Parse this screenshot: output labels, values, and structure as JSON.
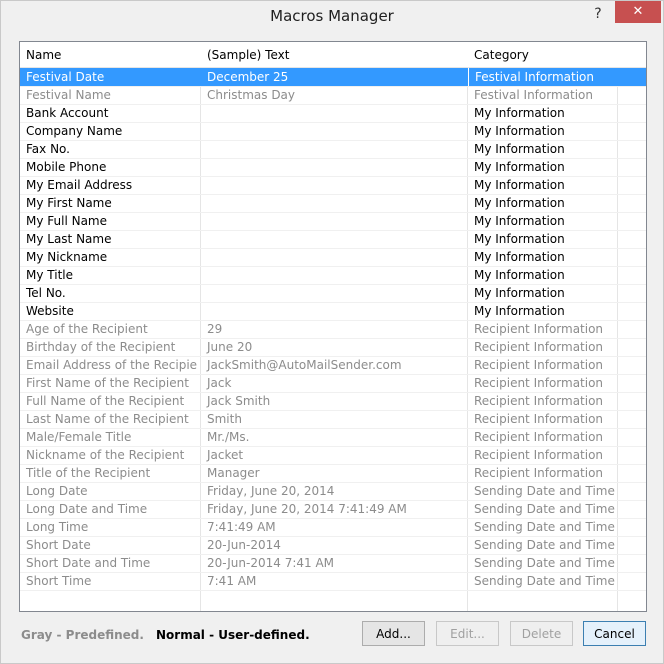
{
  "window": {
    "title": "Macros Manager",
    "help_label": "?",
    "close_label": "✕"
  },
  "columns": [
    "Name",
    "(Sample) Text",
    "Category"
  ],
  "rows": [
    {
      "name": "Festival Date",
      "text": "December 25",
      "category": "Festival Information",
      "kind": "pre",
      "selected": true
    },
    {
      "name": "Festival Name",
      "text": "Christmas Day",
      "category": "Festival Information",
      "kind": "pre"
    },
    {
      "name": "Bank Account",
      "text": "",
      "category": "My Information",
      "kind": "usr"
    },
    {
      "name": "Company Name",
      "text": "",
      "category": "My Information",
      "kind": "usr"
    },
    {
      "name": "Fax No.",
      "text": "",
      "category": "My Information",
      "kind": "usr"
    },
    {
      "name": "Mobile Phone",
      "text": "",
      "category": "My Information",
      "kind": "usr"
    },
    {
      "name": "My Email Address",
      "text": "",
      "category": "My Information",
      "kind": "usr"
    },
    {
      "name": "My First Name",
      "text": "",
      "category": "My Information",
      "kind": "usr"
    },
    {
      "name": "My Full Name",
      "text": "",
      "category": "My Information",
      "kind": "usr"
    },
    {
      "name": "My Last Name",
      "text": "",
      "category": "My Information",
      "kind": "usr"
    },
    {
      "name": "My Nickname",
      "text": "",
      "category": "My Information",
      "kind": "usr"
    },
    {
      "name": "My Title",
      "text": "",
      "category": "My Information",
      "kind": "usr"
    },
    {
      "name": "Tel No.",
      "text": "",
      "category": "My Information",
      "kind": "usr"
    },
    {
      "name": "Website",
      "text": "",
      "category": "My Information",
      "kind": "usr"
    },
    {
      "name": "Age of the Recipient",
      "text": "29",
      "category": "Recipient Information",
      "kind": "pre"
    },
    {
      "name": "Birthday of the Recipient",
      "text": "June 20",
      "category": "Recipient Information",
      "kind": "pre"
    },
    {
      "name": "Email Address of the Recipient",
      "text": "JackSmith@AutoMailSender.com",
      "category": "Recipient Information",
      "kind": "pre"
    },
    {
      "name": "First Name of the Recipient",
      "text": "Jack",
      "category": "Recipient Information",
      "kind": "pre"
    },
    {
      "name": "Full Name of the Recipient",
      "text": "Jack Smith",
      "category": "Recipient Information",
      "kind": "pre"
    },
    {
      "name": "Last Name of the Recipient",
      "text": "Smith",
      "category": "Recipient Information",
      "kind": "pre"
    },
    {
      "name": "Male/Female Title",
      "text": "Mr./Ms.",
      "category": "Recipient Information",
      "kind": "pre"
    },
    {
      "name": "Nickname of the Recipient",
      "text": "Jacket",
      "category": "Recipient Information",
      "kind": "pre"
    },
    {
      "name": "Title of the Recipient",
      "text": "Manager",
      "category": "Recipient Information",
      "kind": "pre"
    },
    {
      "name": "Long Date",
      "text": "Friday, June 20, 2014",
      "category": "Sending Date and Time",
      "kind": "pre"
    },
    {
      "name": "Long Date and Time",
      "text": "Friday, June 20, 2014 7:41:49 AM",
      "category": "Sending Date and Time",
      "kind": "pre"
    },
    {
      "name": "Long Time",
      "text": "7:41:49 AM",
      "category": "Sending Date and Time",
      "kind": "pre"
    },
    {
      "name": "Short Date",
      "text": "20-Jun-2014",
      "category": "Sending Date and Time",
      "kind": "pre"
    },
    {
      "name": "Short Date and Time",
      "text": "20-Jun-2014 7:41 AM",
      "category": "Sending Date and Time",
      "kind": "pre"
    },
    {
      "name": "Short Time",
      "text": "7:41 AM",
      "category": "Sending Date and Time",
      "kind": "pre"
    }
  ],
  "footer": {
    "gray_legend": "Gray - Predefined.",
    "normal_legend": "Normal - User-defined."
  },
  "buttons": {
    "add": "Add...",
    "edit": "Edit...",
    "delete": "Delete",
    "cancel": "Cancel"
  },
  "colors": {
    "selection": "#3399ff",
    "predefined_text": "#8c8c8c",
    "user_text": "#000000"
  }
}
